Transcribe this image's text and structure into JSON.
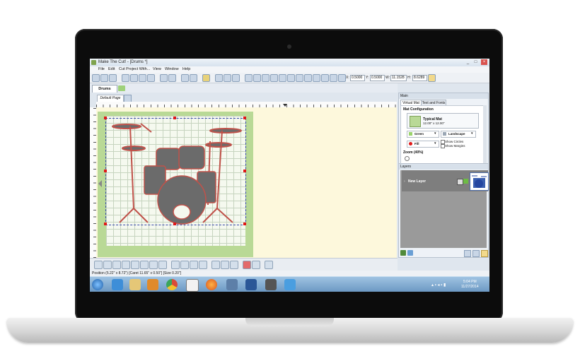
{
  "window": {
    "title": "Make The Cut! - [Drums *]",
    "controls": [
      "_",
      "□",
      "×"
    ]
  },
  "menu": [
    "File",
    "Edit",
    "Cut Project With...",
    "View",
    "Window",
    "Help"
  ],
  "toolbar": {
    "x_label": "X:",
    "x_value": "0.5000",
    "y_label": "Y:",
    "y_value": "0.5000",
    "w_label": "W:",
    "w_value": "11.1528",
    "h_label": "H:",
    "h_value": "8.6289"
  },
  "tabs": {
    "active": "Drums"
  },
  "page_tab": "Default Page",
  "main_panel": {
    "title": "Main",
    "tabs": [
      "Virtual Mat",
      "Text and Fonts"
    ],
    "mat_configuration_label": "Mat Configuration",
    "mat_name": "Typical Mat",
    "mat_size": "12.00\" x 12.00\"",
    "color": "Green",
    "orientation": "Landscape",
    "fill": "Fill",
    "show_circles": "Show Circles",
    "show_margins": "Show Margins",
    "zoom": "Zoom (40%)"
  },
  "layers_panel": {
    "title": "Layers",
    "layer_name": "New Layer"
  },
  "status_text": "Position (5.22\" x 8.72\") [Caret 11.65\" x 0.50\"] [Size 0.20\"]",
  "taskbar": {
    "time": "5:04 PM",
    "date": "11/27/2014"
  },
  "colors": {
    "accent": "#3a6ea5",
    "mat_green": "#b9d996",
    "selection_handle": "#e01818",
    "drum_fill": "#6b6b6b",
    "drum_outline": "#c0524a"
  }
}
